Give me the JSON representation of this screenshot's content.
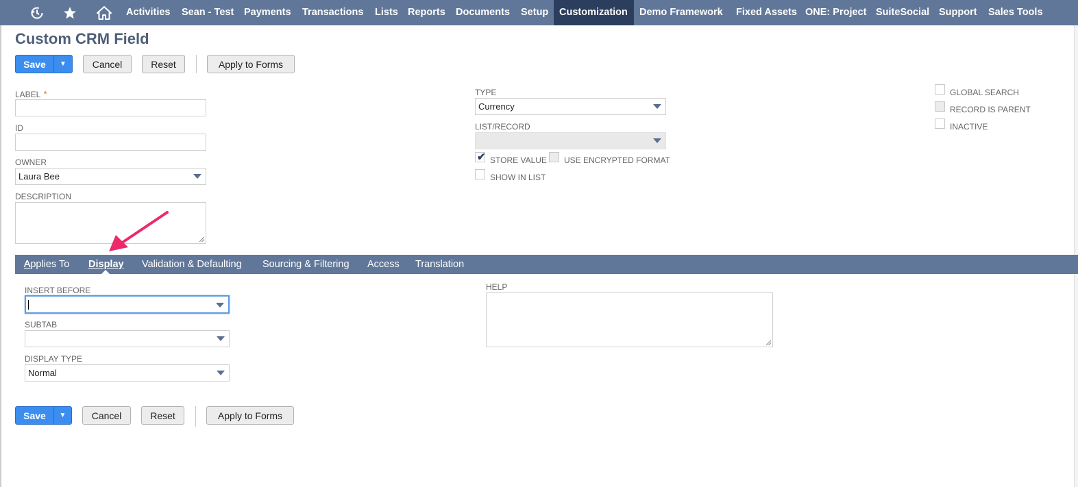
{
  "nav": {
    "items": [
      {
        "label": "Activities"
      },
      {
        "label": "Sean - Test"
      },
      {
        "label": "Payments"
      },
      {
        "label": "Transactions"
      },
      {
        "label": "Lists"
      },
      {
        "label": "Reports"
      },
      {
        "label": "Documents"
      },
      {
        "label": "Setup"
      },
      {
        "label": "Customization"
      },
      {
        "label": "Demo Framework"
      },
      {
        "label": "Fixed Assets"
      },
      {
        "label": "ONE: Project"
      },
      {
        "label": "SuiteSocial"
      },
      {
        "label": "Support"
      },
      {
        "label": "Sales Tools"
      }
    ],
    "active": "Customization",
    "icons": [
      "recent-history-icon",
      "star-icon",
      "home-icon"
    ]
  },
  "page": {
    "title": "Custom CRM Field"
  },
  "buttons": {
    "save": "Save",
    "cancel": "Cancel",
    "reset": "Reset",
    "apply": "Apply to Forms"
  },
  "form": {
    "label": {
      "label": "LABEL",
      "required": "*",
      "value": ""
    },
    "id": {
      "label": "ID",
      "value": ""
    },
    "owner": {
      "label": "OWNER",
      "value": "Laura Bee"
    },
    "description": {
      "label": "DESCRIPTION",
      "value": ""
    },
    "type": {
      "label": "TYPE",
      "value": "Currency"
    },
    "list_record": {
      "label": "LIST/RECORD",
      "value": ""
    },
    "store_value": {
      "label": "STORE VALUE",
      "checked": true
    },
    "use_encrypted": {
      "label": "USE ENCRYPTED FORMAT",
      "checked": false
    },
    "show_in_list": {
      "label": "SHOW IN LIST",
      "checked": false
    },
    "global_search": {
      "label": "GLOBAL SEARCH",
      "checked": false
    },
    "record_is_parent": {
      "label": "RECORD IS PARENT",
      "checked": false
    },
    "inactive": {
      "label": "INACTIVE",
      "checked": false
    }
  },
  "subtabs": {
    "items": [
      {
        "label": "Applies To"
      },
      {
        "label": "Display"
      },
      {
        "label": "Validation & Defaulting"
      },
      {
        "label": "Sourcing & Filtering"
      },
      {
        "label": "Access"
      },
      {
        "label": "Translation"
      }
    ],
    "active": "Display"
  },
  "display": {
    "insert_before": {
      "label": "INSERT BEFORE",
      "value": ""
    },
    "subtab": {
      "label": "SUBTAB",
      "value": ""
    },
    "display_type": {
      "label": "DISPLAY TYPE",
      "value": "Normal"
    },
    "help": {
      "label": "HELP",
      "value": ""
    }
  },
  "colors": {
    "nav": "#607799",
    "nav_active": "#2c3e5e",
    "save": "#3b8ef0",
    "annotation": "#ec2a6a"
  }
}
